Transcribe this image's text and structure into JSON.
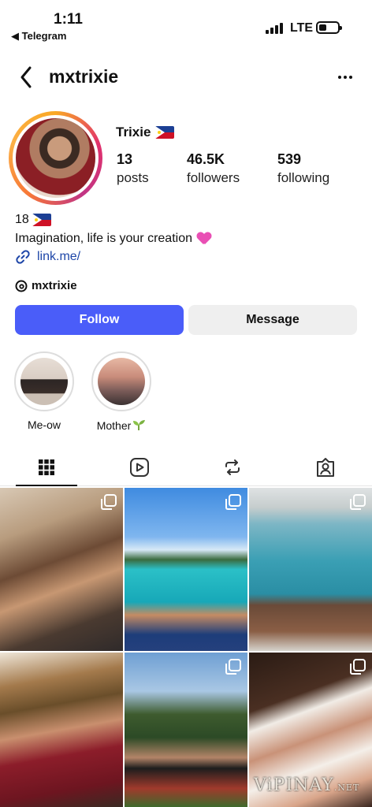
{
  "status_bar": {
    "time": "1:11",
    "back_to_app": "◀ Telegram",
    "network": "LTE"
  },
  "header": {
    "username": "mxtrixie"
  },
  "profile": {
    "display_name": "Trixie",
    "stats": {
      "posts_count": "13",
      "posts_label": "posts",
      "followers_count": "46.5K",
      "followers_label": "followers",
      "following_count": "539",
      "following_label": "following"
    },
    "bio_line1": "18",
    "bio_line2": "Imagination, life is your creation",
    "link": "link.me/",
    "threads_handle": "mxtrixie"
  },
  "actions": {
    "follow_label": "Follow",
    "message_label": "Message"
  },
  "highlights": [
    {
      "label": "Me-ow"
    },
    {
      "label": "Mother"
    }
  ],
  "tabs": [
    "grid-icon",
    "reels-icon",
    "reposts-icon",
    "tagged-icon"
  ],
  "colors": {
    "follow_button": "#4a5df9",
    "message_button": "#efefef",
    "link": "#1e46a8"
  },
  "watermark": {
    "main": "ViPINAY",
    "suffix": ".NET"
  }
}
